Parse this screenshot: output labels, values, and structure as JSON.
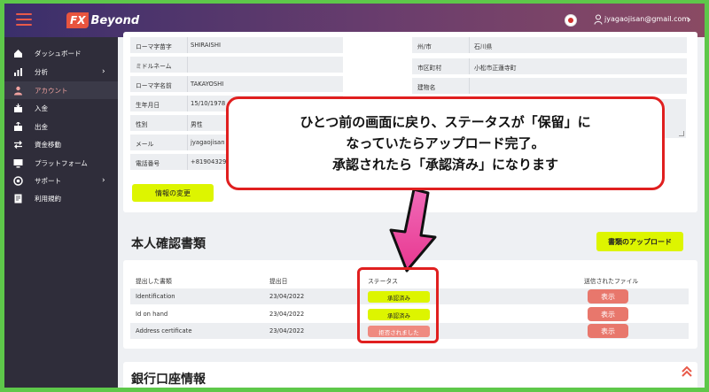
{
  "header": {
    "logo_fx": "FX",
    "logo_rest": "Beyond",
    "user_email": "jyagaojisan@gmail.com"
  },
  "sidebar": {
    "items": [
      {
        "label": "ダッシュボード",
        "icon": "home-icon"
      },
      {
        "label": "分析",
        "icon": "chart-icon",
        "has_chevron": true
      },
      {
        "label": "アカウント",
        "icon": "user-group-icon",
        "active": true
      },
      {
        "label": "入金",
        "icon": "deposit-icon"
      },
      {
        "label": "出金",
        "icon": "withdraw-icon"
      },
      {
        "label": "資金移動",
        "icon": "transfer-icon"
      },
      {
        "label": "プラットフォーム",
        "icon": "monitor-icon"
      },
      {
        "label": "サポート",
        "icon": "support-icon",
        "has_chevron": true
      },
      {
        "label": "利用規約",
        "icon": "document-icon"
      }
    ]
  },
  "profile": {
    "left": [
      {
        "key": "ローマ字苗字",
        "value": "SHIRAISHI"
      },
      {
        "key": "ミドルネーム",
        "value": ""
      },
      {
        "key": "ローマ字名前",
        "value": "TAKAYOSHI"
      },
      {
        "key": "生年月日",
        "value": "15/10/1978"
      },
      {
        "key": "性別",
        "value": "男性"
      },
      {
        "key": "メール",
        "value": "jyagaojisan"
      },
      {
        "key": "電話番号",
        "value": "+81904329"
      }
    ],
    "right": [
      {
        "key": "州/市",
        "value": "石川県"
      },
      {
        "key": "市区町村",
        "value": "小松市正蓮寺町"
      },
      {
        "key": "建物名",
        "value": ""
      }
    ],
    "edit_button": "情報の変更"
  },
  "documents": {
    "title": "本人確認書類",
    "upload_button": "書類のアップロード",
    "headers": {
      "doc": "提出した書類",
      "date": "提出日",
      "status": "ステータス",
      "file": "送信されたファイル"
    },
    "rows": [
      {
        "doc": "Identification",
        "date": "23/04/2022",
        "status": "承認済み",
        "status_type": "approved",
        "action": "表示"
      },
      {
        "doc": "Id on hand",
        "date": "23/04/2022",
        "status": "承認済み",
        "status_type": "approved",
        "action": "表示"
      },
      {
        "doc": "Address certificate",
        "date": "23/04/2022",
        "status": "拒否されました",
        "status_type": "rejected",
        "action": "表示"
      }
    ]
  },
  "bank": {
    "title": "銀行口座情報"
  },
  "callout": {
    "line1": "ひとつ前の画面に戻り、ステータスが「保留」に",
    "line2": "なっていたらアップロード完了。",
    "line3": "承認されたら「承認済み」になります"
  },
  "colors": {
    "accent_lime": "#ddf500",
    "view_button": "#e8776c",
    "highlight_red": "#e01f1f",
    "sidebar_bg": "#2f2d3a",
    "page_border": "#5ec84a"
  }
}
